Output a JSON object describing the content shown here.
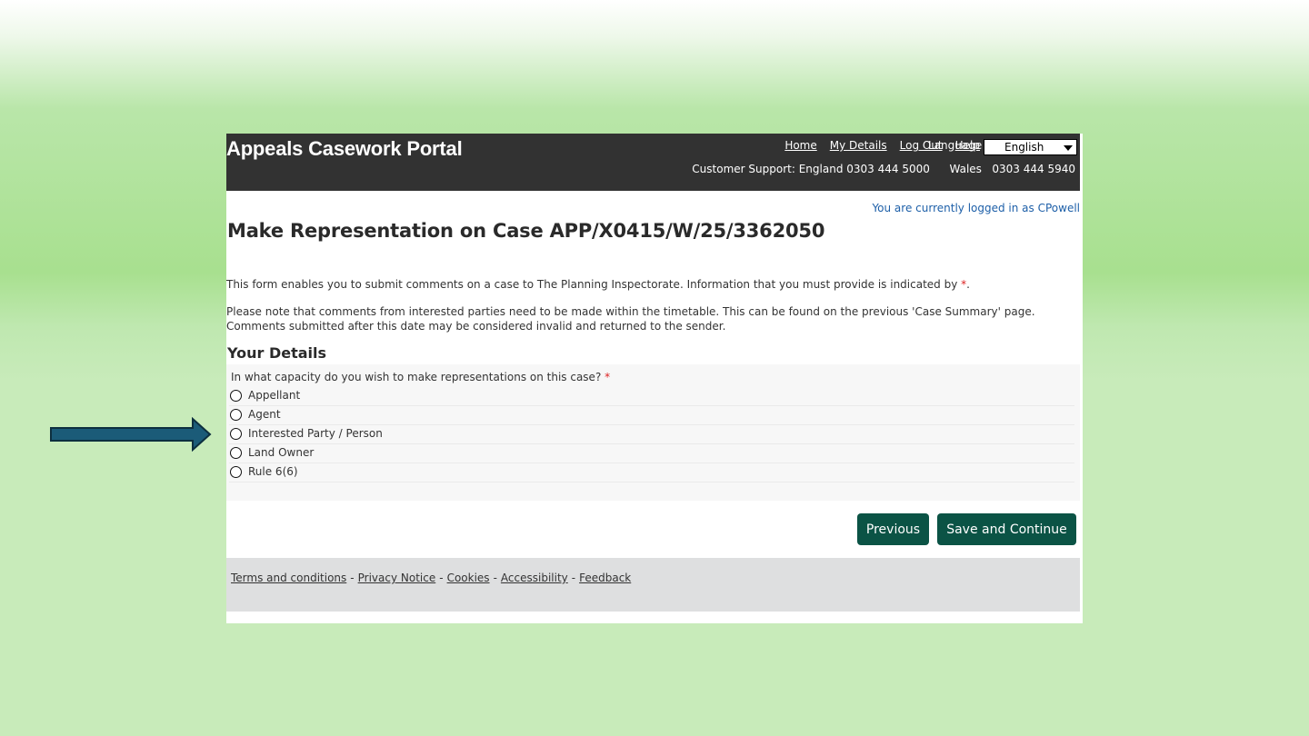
{
  "header": {
    "title": "Appeals Casework Portal",
    "nav": {
      "home": "Home",
      "my_details": "My Details",
      "log_out": "Log Out",
      "help": "Help"
    },
    "language_label": "Language",
    "language_selected": "English",
    "support_label": "Customer Support:",
    "support_england": "England 0303 444 5000",
    "support_wales": "Wales   0303 444 5940"
  },
  "logged_in_text": "You are currently logged in as CPowell",
  "page_title": "Make Representation on Case APP/X0415/W/25/3362050",
  "intro_text": "This form enables you to submit comments on a case to The Planning Inspectorate. Information that you must provide is indicated by",
  "required_marker": "*",
  "intro_end": ".",
  "note_line1": "Please note that comments from interested parties need to be made within the timetable. This can be found on the previous 'Case Summary' page.",
  "note_line2": "Comments submitted after this date may be considered invalid and returned to the sender.",
  "section_title": "Your Details",
  "question": {
    "text": "In what capacity do you wish to make representations on this case?",
    "required_marker": "*",
    "options": [
      "Appellant",
      "Agent",
      "Interested Party / Person",
      "Land Owner",
      "Rule 6(6)"
    ]
  },
  "buttons": {
    "previous": "Previous",
    "save_continue": "Save and Continue"
  },
  "footer": {
    "links": [
      "Terms and conditions",
      "Privacy Notice",
      "Cookies",
      "Accessibility",
      "Feedback"
    ],
    "separator": "-"
  },
  "colors": {
    "header_bg": "#323232",
    "button_bg": "#0b5345",
    "arrow_fill": "#1b5b78",
    "link_blue": "#1d5fa8",
    "required_red": "#dd2222"
  },
  "icons": {
    "pointer": "arrow-right-icon",
    "dropdown": "caret-down-icon",
    "radio": "radio-unchecked-icon"
  }
}
